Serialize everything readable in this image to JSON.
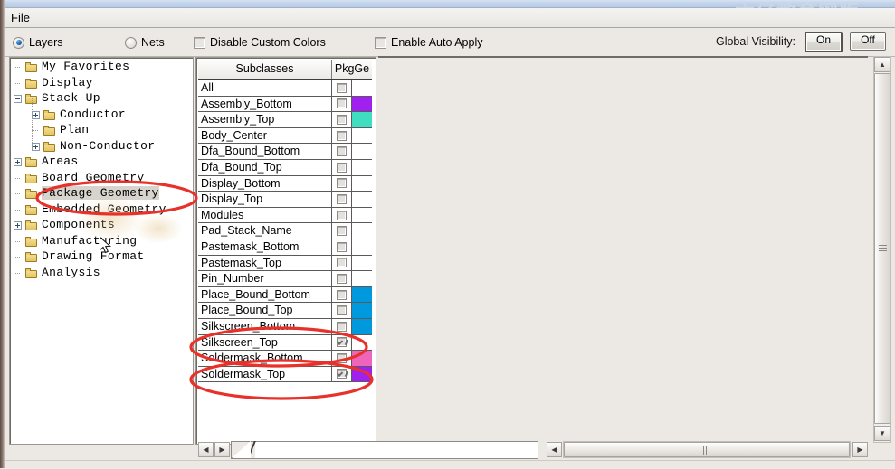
{
  "window": {
    "watermark": "六亿教育网版",
    "menu": {
      "file": "File"
    }
  },
  "toolbar": {
    "layers_label": "Layers",
    "nets_label": "Nets",
    "disable_custom_colors_label": "Disable Custom Colors",
    "enable_auto_apply_label": "Enable Auto Apply",
    "global_visibility_label": "Global Visibility:",
    "on_label": "On",
    "off_label": "Off",
    "layers_selected": true,
    "nets_selected": false,
    "disable_custom_colors_checked": false,
    "enable_auto_apply_checked": false
  },
  "tree": {
    "items": [
      {
        "label": "My Favorites",
        "depth": 1,
        "expander": "none",
        "selected": false
      },
      {
        "label": "Display",
        "depth": 1,
        "expander": "none",
        "selected": false
      },
      {
        "label": "Stack-Up",
        "depth": 1,
        "expander": "minus",
        "selected": false
      },
      {
        "label": "Conductor",
        "depth": 2,
        "expander": "plus",
        "selected": false
      },
      {
        "label": "Plan",
        "depth": 2,
        "expander": "none",
        "selected": false
      },
      {
        "label": "Non-Conductor",
        "depth": 2,
        "expander": "plus",
        "selected": false
      },
      {
        "label": "Areas",
        "depth": 1,
        "expander": "plus",
        "selected": false
      },
      {
        "label": "Board Geometry",
        "depth": 1,
        "expander": "none",
        "selected": false
      },
      {
        "label": "Package Geometry",
        "depth": 1,
        "expander": "none",
        "selected": true
      },
      {
        "label": "Embedded Geometry",
        "depth": 1,
        "expander": "none",
        "selected": false
      },
      {
        "label": "Components",
        "depth": 1,
        "expander": "plus",
        "selected": false
      },
      {
        "label": "Manufacturing",
        "depth": 1,
        "expander": "none",
        "selected": false
      },
      {
        "label": "Drawing Format",
        "depth": 1,
        "expander": "none",
        "selected": false
      },
      {
        "label": "Analysis",
        "depth": 1,
        "expander": "none",
        "selected": false
      }
    ]
  },
  "table": {
    "headers": {
      "name": "Subclasses",
      "pkg": "PkgGe"
    },
    "rows": [
      {
        "name": "All",
        "checked": false,
        "color": ""
      },
      {
        "name": "Assembly_Bottom",
        "checked": false,
        "color": "#a020f0"
      },
      {
        "name": "Assembly_Top",
        "checked": false,
        "color": "#3fdec0"
      },
      {
        "name": "Body_Center",
        "checked": false,
        "color": ""
      },
      {
        "name": "Dfa_Bound_Bottom",
        "checked": false,
        "color": ""
      },
      {
        "name": "Dfa_Bound_Top",
        "checked": false,
        "color": ""
      },
      {
        "name": "Display_Bottom",
        "checked": false,
        "color": ""
      },
      {
        "name": "Display_Top",
        "checked": false,
        "color": ""
      },
      {
        "name": "Modules",
        "checked": false,
        "color": ""
      },
      {
        "name": "Pad_Stack_Name",
        "checked": false,
        "color": ""
      },
      {
        "name": "Pastemask_Bottom",
        "checked": false,
        "color": ""
      },
      {
        "name": "Pastemask_Top",
        "checked": false,
        "color": ""
      },
      {
        "name": "Pin_Number",
        "checked": false,
        "color": ""
      },
      {
        "name": "Place_Bound_Bottom",
        "checked": false,
        "color": "#0099dd"
      },
      {
        "name": "Place_Bound_Top",
        "checked": false,
        "color": "#0099dd"
      },
      {
        "name": "Silkscreen_Bottom",
        "checked": false,
        "color": "#0099dd"
      },
      {
        "name": "Silkscreen_Top",
        "checked": true,
        "color": ""
      },
      {
        "name": "Soldermask_Bottom",
        "checked": false,
        "color": "#ee66bb"
      },
      {
        "name": "Soldermask_Top",
        "checked": true,
        "color": "#a020f0"
      }
    ]
  },
  "annotations": {
    "highlight_tree_item": "Package Geometry",
    "highlight_row_1": "Silkscreen_Top",
    "highlight_row_2": "Soldermask_Top"
  }
}
